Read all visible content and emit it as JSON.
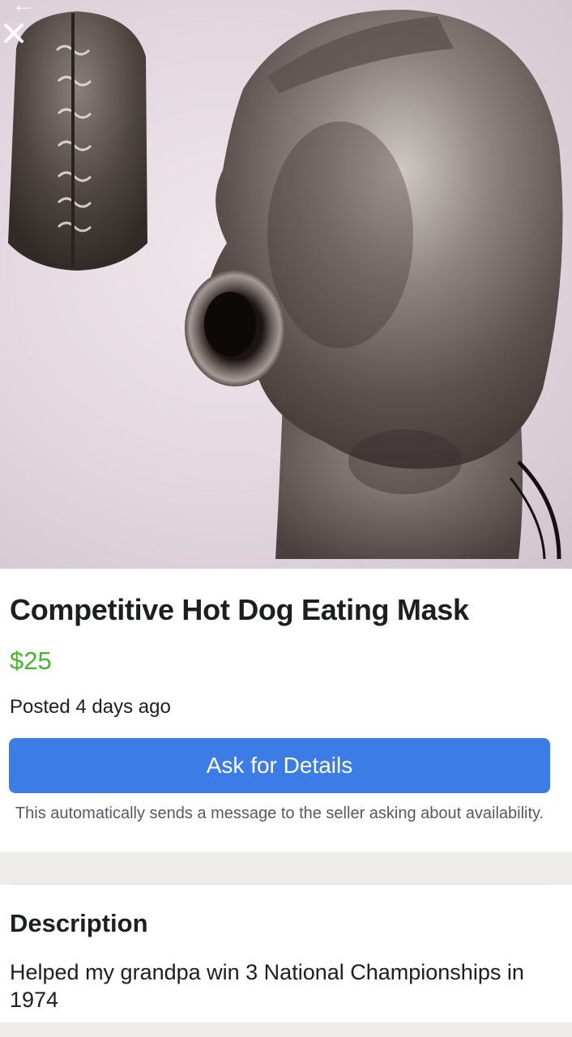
{
  "photo": {
    "subject": "latex head mask with mouth tube",
    "close_icon": "close-x-icon",
    "back_icon": "back-arrow-icon"
  },
  "listing": {
    "title": "Competitive Hot Dog Eating Mask",
    "price": "$25",
    "posted": "Posted 4 days ago",
    "ask_button": "Ask for Details",
    "ask_note": "This automatically sends a message to the seller asking about availability."
  },
  "description": {
    "heading": "Description",
    "body": "Helped my grandpa win 3 National Championships in 1974"
  },
  "colors": {
    "price": "#42b72a",
    "button": "#3b7ce6",
    "text": "#1c1e21",
    "muted": "#555a61"
  }
}
